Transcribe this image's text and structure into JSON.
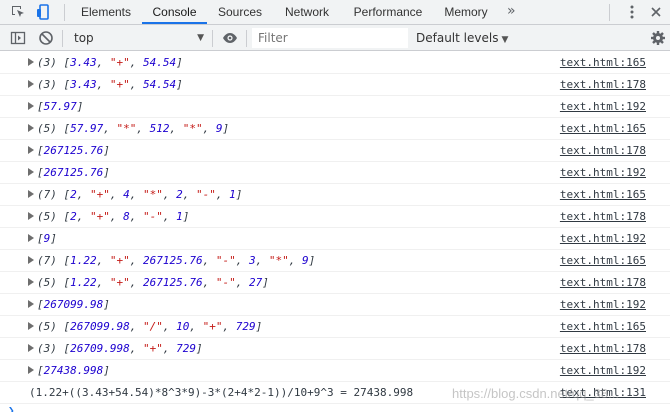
{
  "tabs": [
    {
      "label": "Elements"
    },
    {
      "label": "Console"
    },
    {
      "label": "Sources"
    },
    {
      "label": "Network"
    },
    {
      "label": "Performance"
    },
    {
      "label": "Memory"
    }
  ],
  "more_label": "»",
  "toolbar": {
    "context": "top",
    "filter_placeholder": "Filter",
    "levels": "Default levels"
  },
  "rows": [
    {
      "count": "(3)",
      "items": [
        [
          "num",
          "3.43"
        ],
        [
          "str",
          "\"+\""
        ],
        [
          "num",
          "54.54"
        ]
      ],
      "src": "text.html:165"
    },
    {
      "count": "(3)",
      "items": [
        [
          "num",
          "3.43"
        ],
        [
          "str",
          "\"+\""
        ],
        [
          "num",
          "54.54"
        ]
      ],
      "src": "text.html:178"
    },
    {
      "count": "",
      "items": [
        [
          "num",
          "57.97"
        ]
      ],
      "src": "text.html:192"
    },
    {
      "count": "(5)",
      "items": [
        [
          "num",
          "57.97"
        ],
        [
          "str",
          "\"*\""
        ],
        [
          "num",
          "512"
        ],
        [
          "str",
          "\"*\""
        ],
        [
          "num",
          "9"
        ]
      ],
      "src": "text.html:165"
    },
    {
      "count": "",
      "items": [
        [
          "num",
          "267125.76"
        ]
      ],
      "src": "text.html:178"
    },
    {
      "count": "",
      "items": [
        [
          "num",
          "267125.76"
        ]
      ],
      "src": "text.html:192"
    },
    {
      "count": "(7)",
      "items": [
        [
          "num",
          "2"
        ],
        [
          "str",
          "\"+\""
        ],
        [
          "num",
          "4"
        ],
        [
          "str",
          "\"*\""
        ],
        [
          "num",
          "2"
        ],
        [
          "str",
          "\"-\""
        ],
        [
          "num",
          "1"
        ]
      ],
      "src": "text.html:165"
    },
    {
      "count": "(5)",
      "items": [
        [
          "num",
          "2"
        ],
        [
          "str",
          "\"+\""
        ],
        [
          "num",
          "8"
        ],
        [
          "str",
          "\"-\""
        ],
        [
          "num",
          "1"
        ]
      ],
      "src": "text.html:178"
    },
    {
      "count": "",
      "items": [
        [
          "num",
          "9"
        ]
      ],
      "src": "text.html:192"
    },
    {
      "count": "(7)",
      "items": [
        [
          "num",
          "1.22"
        ],
        [
          "str",
          "\"+\""
        ],
        [
          "num",
          "267125.76"
        ],
        [
          "str",
          "\"-\""
        ],
        [
          "num",
          "3"
        ],
        [
          "str",
          "\"*\""
        ],
        [
          "num",
          "9"
        ]
      ],
      "src": "text.html:165"
    },
    {
      "count": "(5)",
      "items": [
        [
          "num",
          "1.22"
        ],
        [
          "str",
          "\"+\""
        ],
        [
          "num",
          "267125.76"
        ],
        [
          "str",
          "\"-\""
        ],
        [
          "num",
          "27"
        ]
      ],
      "src": "text.html:178"
    },
    {
      "count": "",
      "items": [
        [
          "num",
          "267099.98"
        ]
      ],
      "src": "text.html:192"
    },
    {
      "count": "(5)",
      "items": [
        [
          "num",
          "267099.98"
        ],
        [
          "str",
          "\"/\""
        ],
        [
          "num",
          "10"
        ],
        [
          "str",
          "\"+\""
        ],
        [
          "num",
          "729"
        ]
      ],
      "src": "text.html:165"
    },
    {
      "count": "(3)",
      "items": [
        [
          "num",
          "26709.998"
        ],
        [
          "str",
          "\"+\""
        ],
        [
          "num",
          "729"
        ]
      ],
      "src": "text.html:178"
    },
    {
      "count": "",
      "items": [
        [
          "num",
          "27438.998"
        ]
      ],
      "src": "text.html:192"
    }
  ],
  "log_line": {
    "text": "(1.22+((3.43+54.54)*8^3*9)-3*(2+4*2-1))/10+9^3 = 27438.998",
    "src": "text.html:131"
  },
  "watermark": "https://blog.csdn.net/qq_38..."
}
